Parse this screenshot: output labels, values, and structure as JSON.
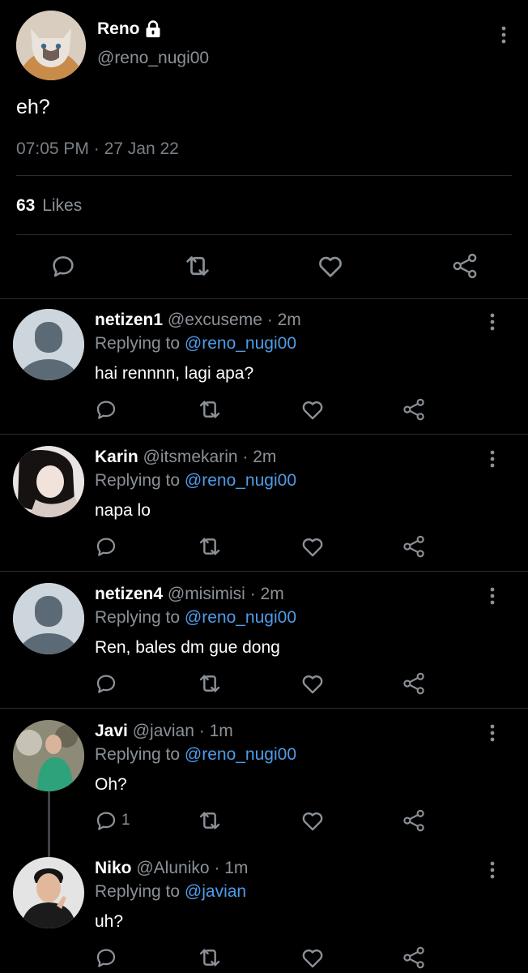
{
  "colors": {
    "background": "#000000",
    "text_primary": "#ffffff",
    "text_secondary": "#8b9197",
    "link": "#4f9be8",
    "divider": "#2a2d31",
    "icon": "#8b9197"
  },
  "main_tweet": {
    "author_name": "Reno",
    "author_handle": "@reno_nugi00",
    "protected_icon": "lock-icon",
    "text": "eh?",
    "time": "07:05 PM",
    "separator": "·",
    "date": "27 Jan 22",
    "likes_count": "63",
    "likes_label": "Likes",
    "action_icons": [
      "reply-icon",
      "retweet-icon",
      "like-icon",
      "share-icon"
    ]
  },
  "replies": [
    {
      "name": "netizen1",
      "handle": "@excuseme",
      "dot": "·",
      "time": "2m",
      "replying_prefix": "Replying to",
      "replying_to": "@reno_nugi00",
      "text": "hai rennnn, lagi apa?",
      "reply_count": "",
      "avatar": "default-avatar"
    },
    {
      "name": "Karin",
      "handle": "@itsmekarin",
      "dot": "·",
      "time": "2m",
      "replying_prefix": "Replying to",
      "replying_to": "@reno_nugi00",
      "text": "napa lo",
      "reply_count": "",
      "avatar": "photo-avatar"
    },
    {
      "name": "netizen4",
      "handle": "@misimisi",
      "dot": "·",
      "time": "2m",
      "replying_prefix": "Replying to",
      "replying_to": "@reno_nugi00",
      "text": "Ren, bales dm gue dong",
      "reply_count": "",
      "avatar": "default-avatar"
    },
    {
      "name": "Javi",
      "handle": "@javian",
      "dot": "·",
      "time": "1m",
      "replying_prefix": "Replying to",
      "replying_to": "@reno_nugi00",
      "text": "Oh?",
      "reply_count": "1",
      "avatar": "photo-avatar"
    },
    {
      "name": "Niko",
      "handle": "@Aluniko",
      "dot": "·",
      "time": "1m",
      "replying_prefix": "Replying to",
      "replying_to": "@javian",
      "text": "uh?",
      "reply_count": "",
      "avatar": "photo-avatar"
    }
  ]
}
